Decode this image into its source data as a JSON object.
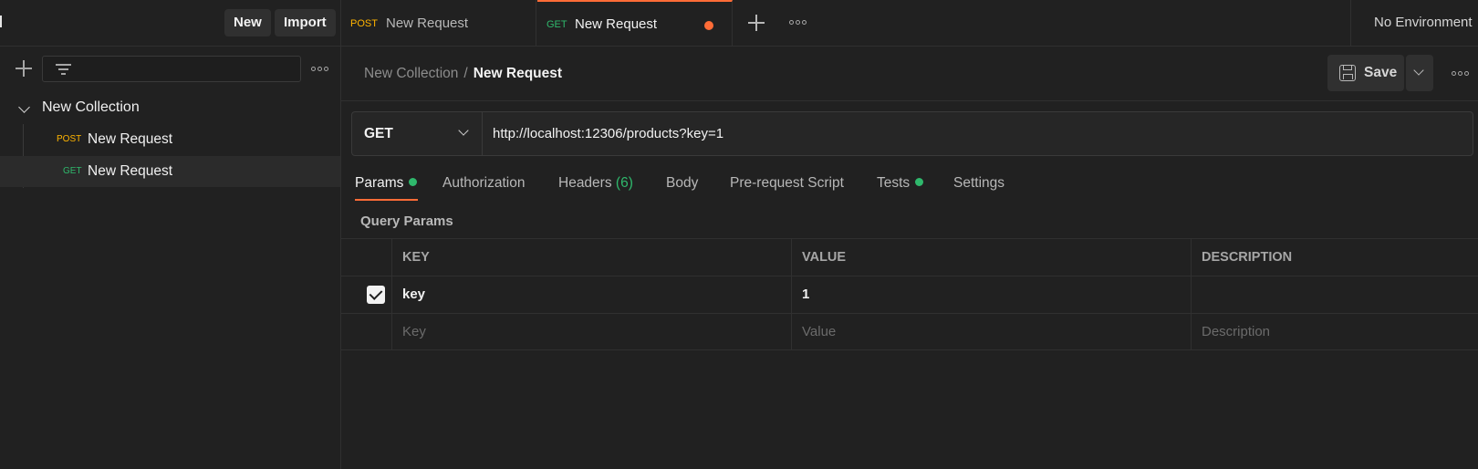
{
  "sidebar": {
    "new_label": "New",
    "import_label": "Import",
    "collection": {
      "name": "New Collection",
      "requests": [
        {
          "method": "POST",
          "name": "New Request"
        },
        {
          "method": "GET",
          "name": "New Request"
        }
      ]
    }
  },
  "tabs": [
    {
      "method": "POST",
      "name": "New Request"
    },
    {
      "method": "GET",
      "name": "New Request",
      "unsaved": true
    }
  ],
  "environment": "No Environment",
  "breadcrumb": {
    "collection": "New Collection",
    "separator": "/",
    "request": "New Request"
  },
  "save_label": "Save",
  "request": {
    "method": "GET",
    "url": "http://localhost:12306/products?key=1"
  },
  "request_tabs": {
    "params": "Params",
    "authorization": "Authorization",
    "headers": "Headers",
    "headers_count": "(6)",
    "body": "Body",
    "prerequest": "Pre-request Script",
    "tests": "Tests",
    "settings": "Settings"
  },
  "query_params": {
    "title": "Query Params",
    "headers": {
      "key": "KEY",
      "value": "VALUE",
      "description": "DESCRIPTION"
    },
    "rows": [
      {
        "checked": true,
        "key": "key",
        "value": "1",
        "description": ""
      }
    ],
    "placeholders": {
      "key": "Key",
      "value": "Value",
      "description": "Description"
    }
  },
  "colors": {
    "accent": "#ff6c37",
    "post": "#ffb400",
    "get": "#2fb86c"
  }
}
